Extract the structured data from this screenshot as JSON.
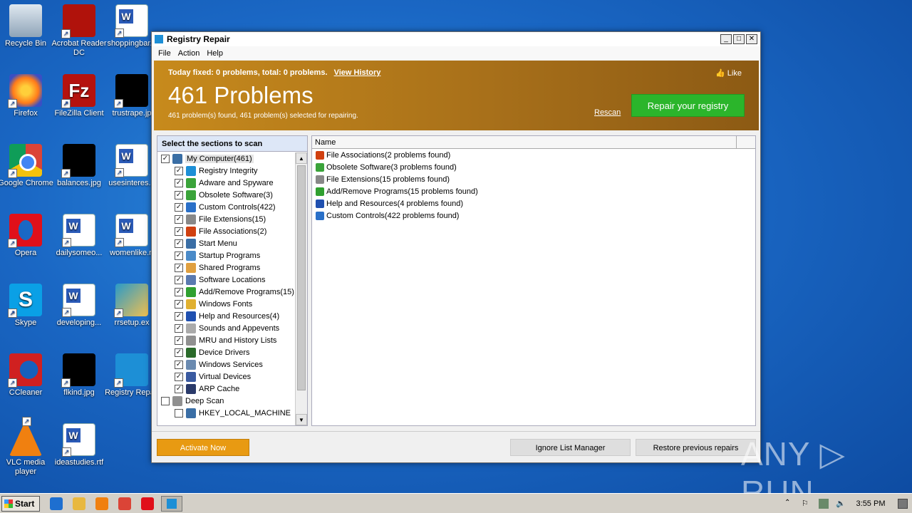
{
  "desktop": {
    "icons": [
      {
        "label": "Recycle Bin",
        "type": "bin"
      },
      {
        "label": "Acrobat Reader DC",
        "type": "acro"
      },
      {
        "label": "shoppingbar...",
        "type": "word"
      },
      {
        "label": "Firefox",
        "type": "ff"
      },
      {
        "label": "FileZilla Client",
        "type": "fz"
      },
      {
        "label": "trustrape.jp",
        "type": "black"
      },
      {
        "label": "Google Chrome",
        "type": "chrome"
      },
      {
        "label": "balances.jpg",
        "type": "black"
      },
      {
        "label": "usesinteres...",
        "type": "word"
      },
      {
        "label": "Opera",
        "type": "opera"
      },
      {
        "label": "dailysomeo...",
        "type": "word"
      },
      {
        "label": "womenlike.rt",
        "type": "word"
      },
      {
        "label": "Skype",
        "type": "skype"
      },
      {
        "label": "developing...",
        "type": "word"
      },
      {
        "label": "rrsetup.ex",
        "type": "rrsetup"
      },
      {
        "label": "CCleaner",
        "type": "cc"
      },
      {
        "label": "flkind.jpg",
        "type": "black"
      },
      {
        "label": "Registry Repair",
        "type": "reg"
      },
      {
        "label": "VLC media player",
        "type": "vlc"
      },
      {
        "label": "ideastudies.rtf",
        "type": "word"
      }
    ]
  },
  "window": {
    "title": "Registry Repair",
    "controls": {
      "minimize": "_",
      "maximize": "□",
      "close": "✕"
    },
    "menu": [
      "File",
      "Action",
      "Help"
    ],
    "banner": {
      "today": "Today fixed: 0 problems, total: 0 problems.",
      "view_history": "View History",
      "like": "Like",
      "big": "461 Problems",
      "sub": "461 problem(s) found, 461 problem(s) selected for repairing.",
      "rescan": "Rescan",
      "repair_button": "Repair your registry"
    },
    "left_panel": {
      "header": "Select the sections to scan",
      "tree": [
        {
          "label": "My Computer(461)",
          "level": 0,
          "checked": true,
          "icon": "computer",
          "color": "#3a6ea5"
        },
        {
          "label": "Registry Integrity",
          "level": 1,
          "checked": true,
          "icon": "registry",
          "color": "#1d8fd6"
        },
        {
          "label": "Adware and Spyware",
          "level": 1,
          "checked": true,
          "icon": "shield",
          "color": "#3aa33a"
        },
        {
          "label": "Obsolete Software(3)",
          "level": 1,
          "checked": true,
          "icon": "trash",
          "color": "#3aa33a"
        },
        {
          "label": "Custom Controls(422)",
          "level": 1,
          "checked": true,
          "icon": "blocks",
          "color": "#2a70c8"
        },
        {
          "label": "File Extensions(15)",
          "level": 1,
          "checked": true,
          "icon": "file",
          "color": "#888888"
        },
        {
          "label": "File Associations(2)",
          "level": 1,
          "checked": true,
          "icon": "letter-a",
          "color": "#d04010"
        },
        {
          "label": "Start Menu",
          "level": 1,
          "checked": true,
          "icon": "window",
          "color": "#3a6ea5"
        },
        {
          "label": "Startup Programs",
          "level": 1,
          "checked": true,
          "icon": "window",
          "color": "#4a8ac8"
        },
        {
          "label": "Shared Programs",
          "level": 1,
          "checked": true,
          "icon": "hand",
          "color": "#e0a040"
        },
        {
          "label": "Software Locations",
          "level": 1,
          "checked": true,
          "icon": "cd",
          "color": "#5a7ab0"
        },
        {
          "label": "Add/Remove Programs(15)",
          "level": 1,
          "checked": true,
          "icon": "recycle",
          "color": "#30a030"
        },
        {
          "label": "Windows Fonts",
          "level": 1,
          "checked": true,
          "icon": "font",
          "color": "#e0b030"
        },
        {
          "label": "Help and Resources(4)",
          "level": 1,
          "checked": true,
          "icon": "help",
          "color": "#2050b0"
        },
        {
          "label": "Sounds and Appevents",
          "level": 1,
          "checked": true,
          "icon": "sound",
          "color": "#aaaaaa"
        },
        {
          "label": "MRU and History Lists",
          "level": 1,
          "checked": true,
          "icon": "history",
          "color": "#909090"
        },
        {
          "label": "Device Drivers",
          "level": 1,
          "checked": true,
          "icon": "chip",
          "color": "#2a6a2a"
        },
        {
          "label": "Windows Services",
          "level": 1,
          "checked": true,
          "icon": "services",
          "color": "#6a8ab0"
        },
        {
          "label": "Virtual Devices",
          "level": 1,
          "checked": true,
          "icon": "devices",
          "color": "#3a5aa0"
        },
        {
          "label": "ARP Cache",
          "level": 1,
          "checked": true,
          "icon": "cache",
          "color": "#2a3a6a"
        },
        {
          "label": "Deep Scan",
          "level": 0,
          "checked": false,
          "icon": "magnifier",
          "color": "#909090"
        },
        {
          "label": "HKEY_LOCAL_MACHINE",
          "level": 1,
          "checked": false,
          "icon": "computer",
          "color": "#3a6ea5"
        }
      ]
    },
    "right_panel": {
      "column": "Name",
      "rows": [
        {
          "label": "File Associations(2 problems found)",
          "icon": "letter-a",
          "color": "#d04010"
        },
        {
          "label": "Obsolete Software(3 problems found)",
          "icon": "trash",
          "color": "#3aa33a"
        },
        {
          "label": "File Extensions(15 problems found)",
          "icon": "file",
          "color": "#888888"
        },
        {
          "label": "Add/Remove Programs(15 problems found)",
          "icon": "recycle",
          "color": "#30a030"
        },
        {
          "label": "Help and Resources(4 problems found)",
          "icon": "help",
          "color": "#2050b0"
        },
        {
          "label": "Custom Controls(422 problems found)",
          "icon": "blocks",
          "color": "#2a70c8"
        }
      ]
    },
    "buttons": {
      "activate": "Activate Now",
      "ignore": "Ignore List Manager",
      "restore": "Restore previous repairs"
    }
  },
  "watermark": "ANY ▷ RUN",
  "taskbar": {
    "start": "Start",
    "pinned": [
      {
        "name": "ie-icon",
        "color": "#1e6fd0"
      },
      {
        "name": "explorer-icon",
        "color": "#e8b840"
      },
      {
        "name": "media-player-icon",
        "color": "#f08010"
      },
      {
        "name": "chrome-icon",
        "color": "#db4437"
      },
      {
        "name": "opera-icon",
        "color": "#e0101a"
      }
    ],
    "time": "3:55 PM"
  }
}
